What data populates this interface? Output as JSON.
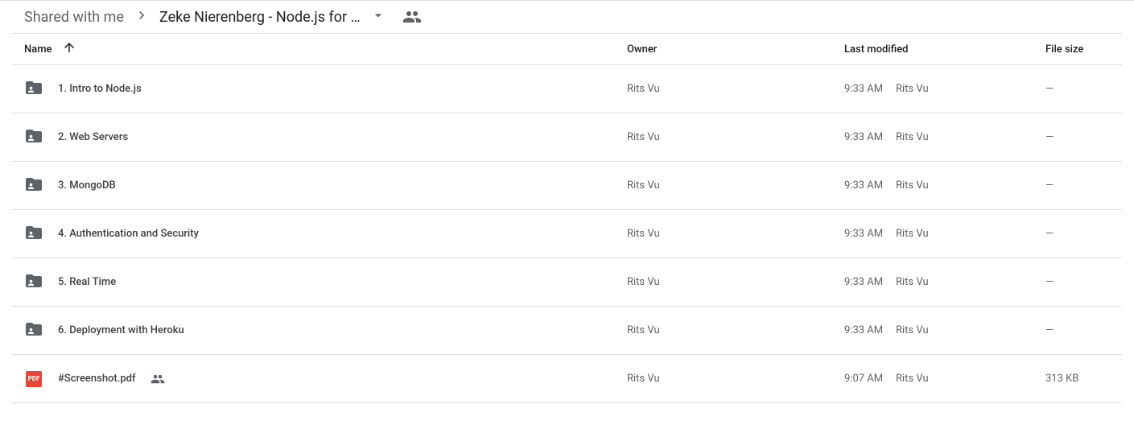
{
  "breadcrumb": {
    "root": "Shared with me",
    "current": "Zeke Nierenberg - Node.js for …"
  },
  "columns": {
    "name": "Name",
    "owner": "Owner",
    "modified": "Last modified",
    "size": "File size"
  },
  "rows": [
    {
      "type": "folder",
      "name": "1. Intro to Node.js",
      "owner": "Rits Vu",
      "modified_time": "9:33 AM",
      "modified_by": "Rits Vu",
      "size": "—",
      "shared": false
    },
    {
      "type": "folder",
      "name": "2. Web Servers",
      "owner": "Rits Vu",
      "modified_time": "9:33 AM",
      "modified_by": "Rits Vu",
      "size": "—",
      "shared": false
    },
    {
      "type": "folder",
      "name": "3. MongoDB",
      "owner": "Rits Vu",
      "modified_time": "9:33 AM",
      "modified_by": "Rits Vu",
      "size": "—",
      "shared": false
    },
    {
      "type": "folder",
      "name": "4. Authentication and Security",
      "owner": "Rits Vu",
      "modified_time": "9:33 AM",
      "modified_by": "Rits Vu",
      "size": "—",
      "shared": false
    },
    {
      "type": "folder",
      "name": "5. Real Time",
      "owner": "Rits Vu",
      "modified_time": "9:33 AM",
      "modified_by": "Rits Vu",
      "size": "—",
      "shared": false
    },
    {
      "type": "folder",
      "name": "6. Deployment with Heroku",
      "owner": "Rits Vu",
      "modified_time": "9:33 AM",
      "modified_by": "Rits Vu",
      "size": "—",
      "shared": false
    },
    {
      "type": "pdf",
      "name": "#Screenshot.pdf",
      "owner": "Rits Vu",
      "modified_time": "9:07 AM",
      "modified_by": "Rits Vu",
      "size": "313 KB",
      "shared": true
    }
  ],
  "icons": {
    "pdf_badge": "PDF"
  }
}
